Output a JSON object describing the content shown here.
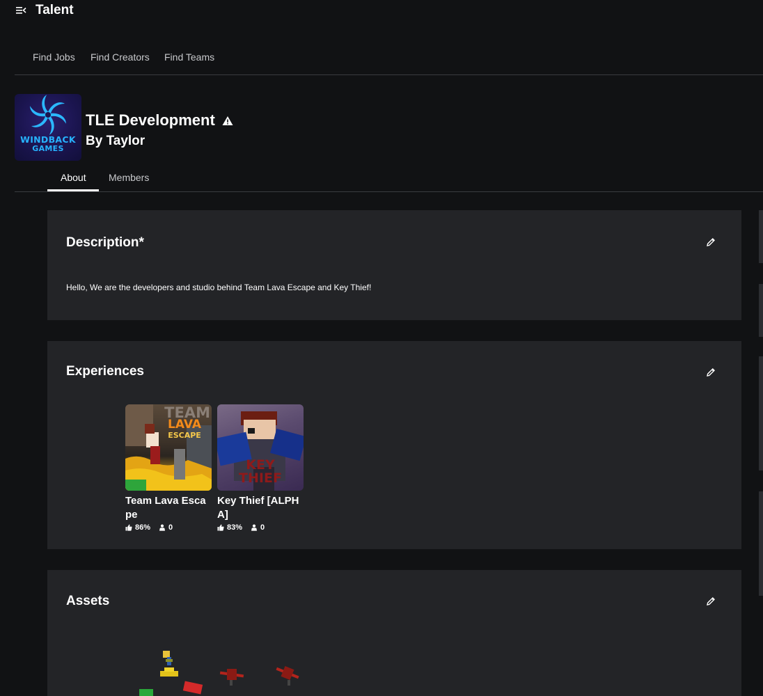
{
  "app": {
    "title": "Talent"
  },
  "nav": {
    "items": [
      "Find Jobs",
      "Find Creators",
      "Find Teams"
    ]
  },
  "team": {
    "name": "TLE Development",
    "owner": "By Taylor",
    "logo_line1": "WINDBACK",
    "logo_line2": "GAMES"
  },
  "tabs": [
    {
      "label": "About"
    },
    {
      "label": "Members"
    }
  ],
  "description": {
    "title": "Description*",
    "text": "Hello, We are the developers and studio behind Team Lava Escape and Key Thief!"
  },
  "experiences": {
    "title": "Experiences",
    "items": [
      {
        "name": "Team Lava Escape",
        "rating": "86%",
        "players": "0",
        "thumb_text_1": "TEAM",
        "thumb_text_2": "LAVA",
        "thumb_text_3": "ESCAPE"
      },
      {
        "name": "Key Thief [ALPHA]",
        "rating": "83%",
        "players": "0",
        "thumb_text_1": "KEY",
        "thumb_text_2": "THIEF"
      }
    ]
  },
  "assets": {
    "title": "Assets"
  },
  "colors": {
    "page_bg": "#111214",
    "card_bg": "#232427",
    "accent_logo": "#27b3ff"
  },
  "icons": [
    "menu-collapse-icon",
    "warning-icon",
    "pencil-icon",
    "thumbs-up-icon",
    "player-icon"
  ]
}
